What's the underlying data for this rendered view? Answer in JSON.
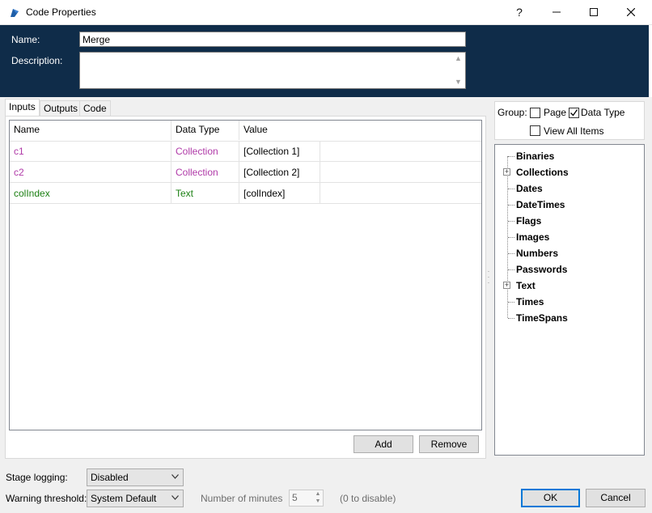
{
  "window": {
    "title": "Code Properties",
    "help_glyph": "?",
    "minimize_glyph": "—",
    "maximize_glyph": "☐",
    "close_glyph": "✕",
    "app_icon": "blue-prism-icon"
  },
  "header": {
    "name_label": "Name:",
    "name_value": "Merge",
    "description_label": "Description:",
    "description_value": ""
  },
  "tabs": [
    {
      "label": "Inputs",
      "active": true
    },
    {
      "label": "Outputs",
      "active": false
    },
    {
      "label": "Code",
      "active": false
    }
  ],
  "grid": {
    "columns": [
      "Name",
      "Data Type",
      "Value"
    ],
    "rows": [
      {
        "name": "c1",
        "type": "Collection",
        "value": "[Collection 1]",
        "color": "#b03aa8"
      },
      {
        "name": "c2",
        "type": "Collection",
        "value": "[Collection 2]",
        "color": "#b03aa8"
      },
      {
        "name": "colIndex",
        "type": "Text",
        "value": "[colIndex]",
        "color": "#1b7f12"
      }
    ]
  },
  "buttons": {
    "add": "Add",
    "remove": "Remove",
    "ok": "OK",
    "cancel": "Cancel"
  },
  "group": {
    "label": "Group:",
    "page_label": "Page",
    "page_checked": false,
    "datatype_label": "Data Type",
    "datatype_checked": true,
    "viewall_label": "View All Items",
    "viewall_checked": false
  },
  "tree": {
    "items": [
      {
        "label": "Binaries",
        "expandable": false
      },
      {
        "label": "Collections",
        "expandable": true
      },
      {
        "label": "Dates",
        "expandable": false
      },
      {
        "label": "DateTimes",
        "expandable": false
      },
      {
        "label": "Flags",
        "expandable": false
      },
      {
        "label": "Images",
        "expandable": false
      },
      {
        "label": "Numbers",
        "expandable": false
      },
      {
        "label": "Passwords",
        "expandable": false
      },
      {
        "label": "Text",
        "expandable": true
      },
      {
        "label": "Times",
        "expandable": false
      },
      {
        "label": "TimeSpans",
        "expandable": false
      }
    ]
  },
  "footer": {
    "stage_logging_label": "Stage logging:",
    "stage_logging_value": "Disabled",
    "warning_threshold_label": "Warning threshold:",
    "warning_threshold_value": "System Default",
    "minutes_label": "Number of minutes",
    "minutes_value": "5",
    "disable_hint": "(0 to disable)"
  },
  "colors": {
    "header_bg": "#0f2c49",
    "collection_text": "#b03aa8",
    "text_type": "#1b7f12",
    "ok_border": "#0078d7"
  }
}
